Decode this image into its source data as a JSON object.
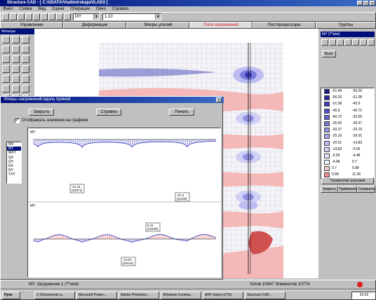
{
  "window": {
    "title": "Structure CAD - [ C:\\SDATA\\Vladimirskaja\\VLAD3 ]"
  },
  "menu": [
    "Файл",
    "Схема",
    "Вид",
    "Сцена",
    "Операции",
    "Окно",
    "Справка"
  ],
  "toolbar": {
    "combo1": "MY",
    "combo2": "1.10"
  },
  "tabs": [
    {
      "label": "Управление",
      "active": false
    },
    {
      "label": "Деформации",
      "active": false
    },
    {
      "label": "Эпюры усилий",
      "active": false
    },
    {
      "label": "Поля напряжений",
      "active": true
    },
    {
      "label": "Постпроцессоры",
      "active": false
    },
    {
      "label": "Группы",
      "active": false
    }
  ],
  "left_panel": {
    "title": "Фильтры отображения"
  },
  "right_panel": {
    "title": "MY (Т*м/м)",
    "button_vykl": "Выкл",
    "manage_button": "Управление шкалами",
    "bottom_buttons": [
      "Закрыть",
      "Применить",
      "Сохранить"
    ],
    "legend": [
      {
        "from": "-61.44",
        "to": "-56.26",
        "color": "#1a1a8c"
      },
      {
        "from": "-56.26",
        "to": "-51.08",
        "color": "#2a2aa0"
      },
      {
        "from": "-51.08",
        "to": "-45.9",
        "color": "#3c3cb4"
      },
      {
        "from": "-45.9",
        "to": "-40.72",
        "color": "#5050c4"
      },
      {
        "from": "-40.72",
        "to": "-35.55",
        "color": "#6464d0"
      },
      {
        "from": "-35.55",
        "to": "-30.37",
        "color": "#7a7adc"
      },
      {
        "from": "-30.37",
        "to": "-25.19",
        "color": "#9090e4"
      },
      {
        "from": "-25.19",
        "to": "-20.01",
        "color": "#a6a6ec"
      },
      {
        "from": "-20.01",
        "to": "-14.83",
        "color": "#bcbcf2"
      },
      {
        "from": "-14.83",
        "to": "-9.65",
        "color": "#d0d0f6"
      },
      {
        "from": "-9.65",
        "to": "-4.48",
        "color": "#e2e2fa"
      },
      {
        "from": "-4.48",
        "to": "0.7",
        "color": "#f2f2ff"
      },
      {
        "from": "0.7",
        "to": "5.88",
        "color": "#f4c8c8"
      },
      {
        "from": "5.88",
        "to": "11.06",
        "color": "#ec8c8c"
      }
    ]
  },
  "dialog": {
    "title": "Эпюры напряжений вдоль прямой",
    "close_btn": "Закрыть",
    "help_btn": "Справка",
    "print_btn": "Печать",
    "checkbox_label": "Отображать значения на графике",
    "list_items": [
      "MX",
      "MY",
      "MXY",
      "QX",
      "QY",
      "NX",
      "NY",
      "TXY"
    ],
    "selected_item": 1,
    "plot1": {
      "label": "MY",
      "annotations": [
        {
          "value": "-21.31",
          "node": "[10071]"
        },
        {
          "value": "-21.2",
          "node": "[11159]"
        }
      ]
    },
    "plot2": {
      "label": "MY",
      "annotations": [
        {
          "value": "-19.64",
          "node": "[10014]"
        },
        {
          "value": "6.41",
          "node": "[10156]"
        }
      ]
    }
  },
  "status": {
    "left": "MY. Загружение 1 (Т*м/м)",
    "right": "Узлов 10647  Элементов 10774"
  },
  "taskbar": {
    "start": "Пуск",
    "items": [
      "C:\\Documents a...",
      "Microsoft Power...",
      "Adobe Photosho...",
      "Windows Comma...",
      "AVP поиск (17%)",
      "Structure CAD ..."
    ],
    "clock": "20:05"
  },
  "colors": {
    "title_blue": "#00107a",
    "active_tab": "#e02020",
    "neg_plot": "#3030c0",
    "pos_plot": "#e03030"
  }
}
